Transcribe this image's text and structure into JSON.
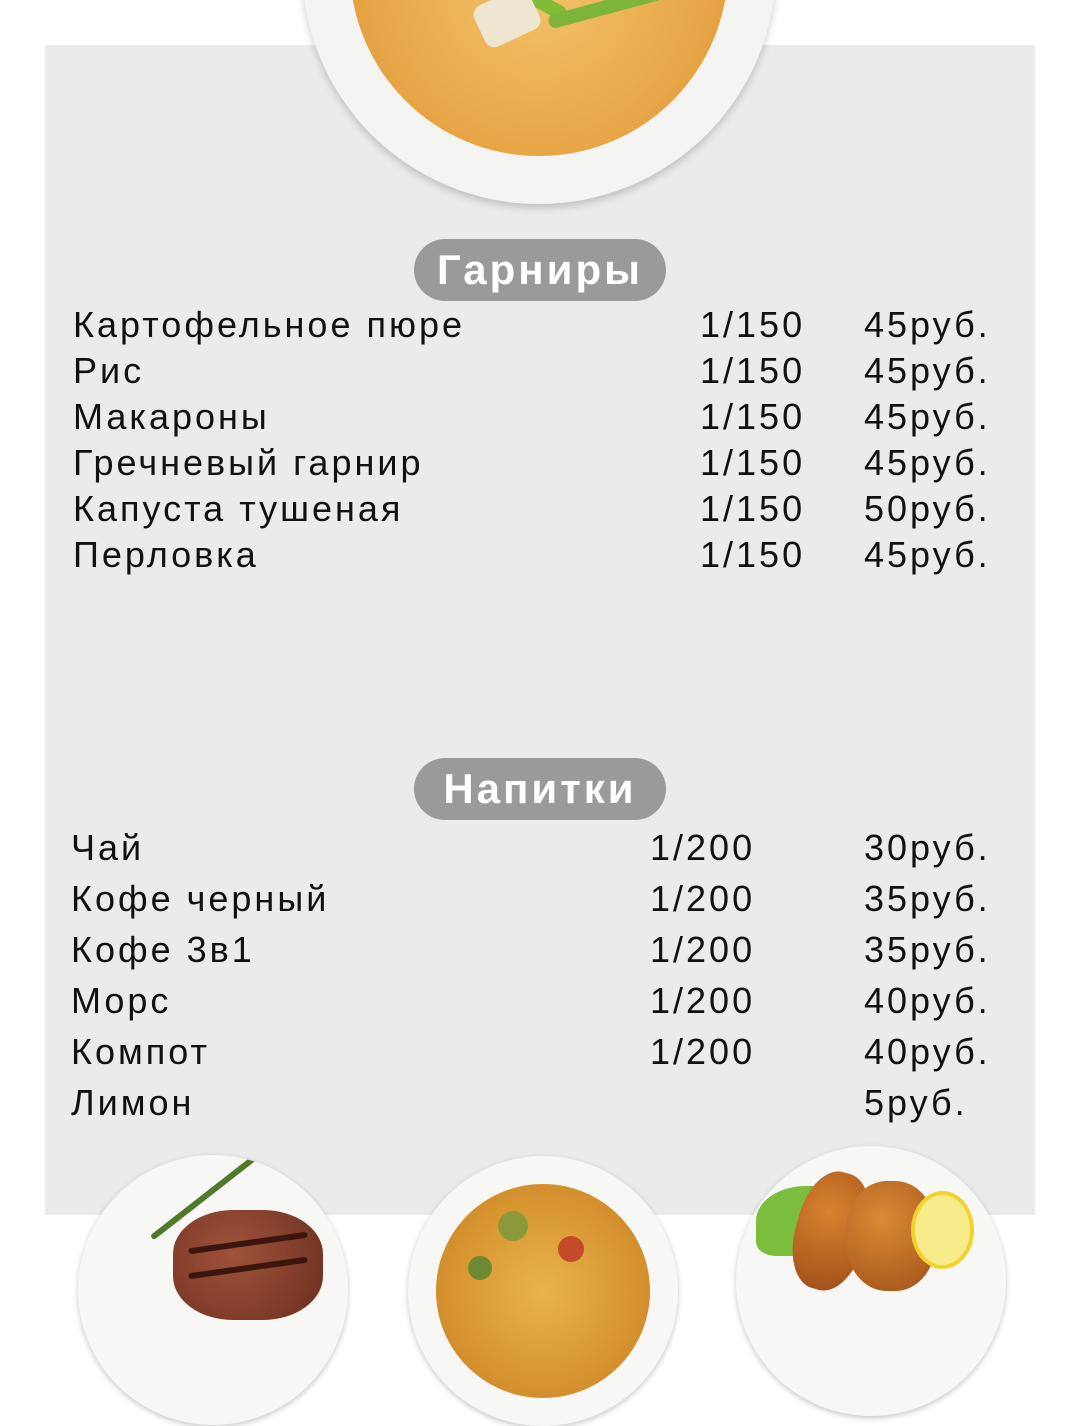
{
  "garnish": {
    "title": "Гарниры",
    "items": [
      {
        "name": "Картофельное пюре",
        "weight": "1/150",
        "price": "45руб."
      },
      {
        "name": "Рис",
        "weight": "1/150",
        "price": "45руб."
      },
      {
        "name": "Макароны",
        "weight": "1/150",
        "price": "45руб."
      },
      {
        "name": "Гречневый гарнир",
        "weight": "1/150",
        "price": "45руб."
      },
      {
        "name": "Капуста тушеная",
        "weight": "1/150",
        "price": "50руб."
      },
      {
        "name": "Перловка",
        "weight": "1/150",
        "price": "45руб."
      }
    ]
  },
  "drinks": {
    "title": "Напитки",
    "items": [
      {
        "name": "Чай",
        "weight": "1/200",
        "price": "30руб."
      },
      {
        "name": "Кофе черный",
        "weight": "1/200",
        "price": "35руб."
      },
      {
        "name": "Кофе 3в1",
        "weight": "1/200",
        "price": "35руб."
      },
      {
        "name": "Морс",
        "weight": "1/200",
        "price": "40руб."
      },
      {
        "name": "Компот",
        "weight": "1/200",
        "price": "40руб."
      },
      {
        "name": "Лимон",
        "weight": "",
        "price": "5руб."
      }
    ]
  },
  "colors": {
    "panel": "#ebebeb",
    "pill": "#9a9a9a",
    "pill_text": "#ffffff",
    "text": "#111111"
  },
  "images": {
    "top": "soup-bowl-photo",
    "bottom": [
      "steak-plate-photo",
      "pizza-plate-photo",
      "chicken-plate-photo"
    ]
  }
}
